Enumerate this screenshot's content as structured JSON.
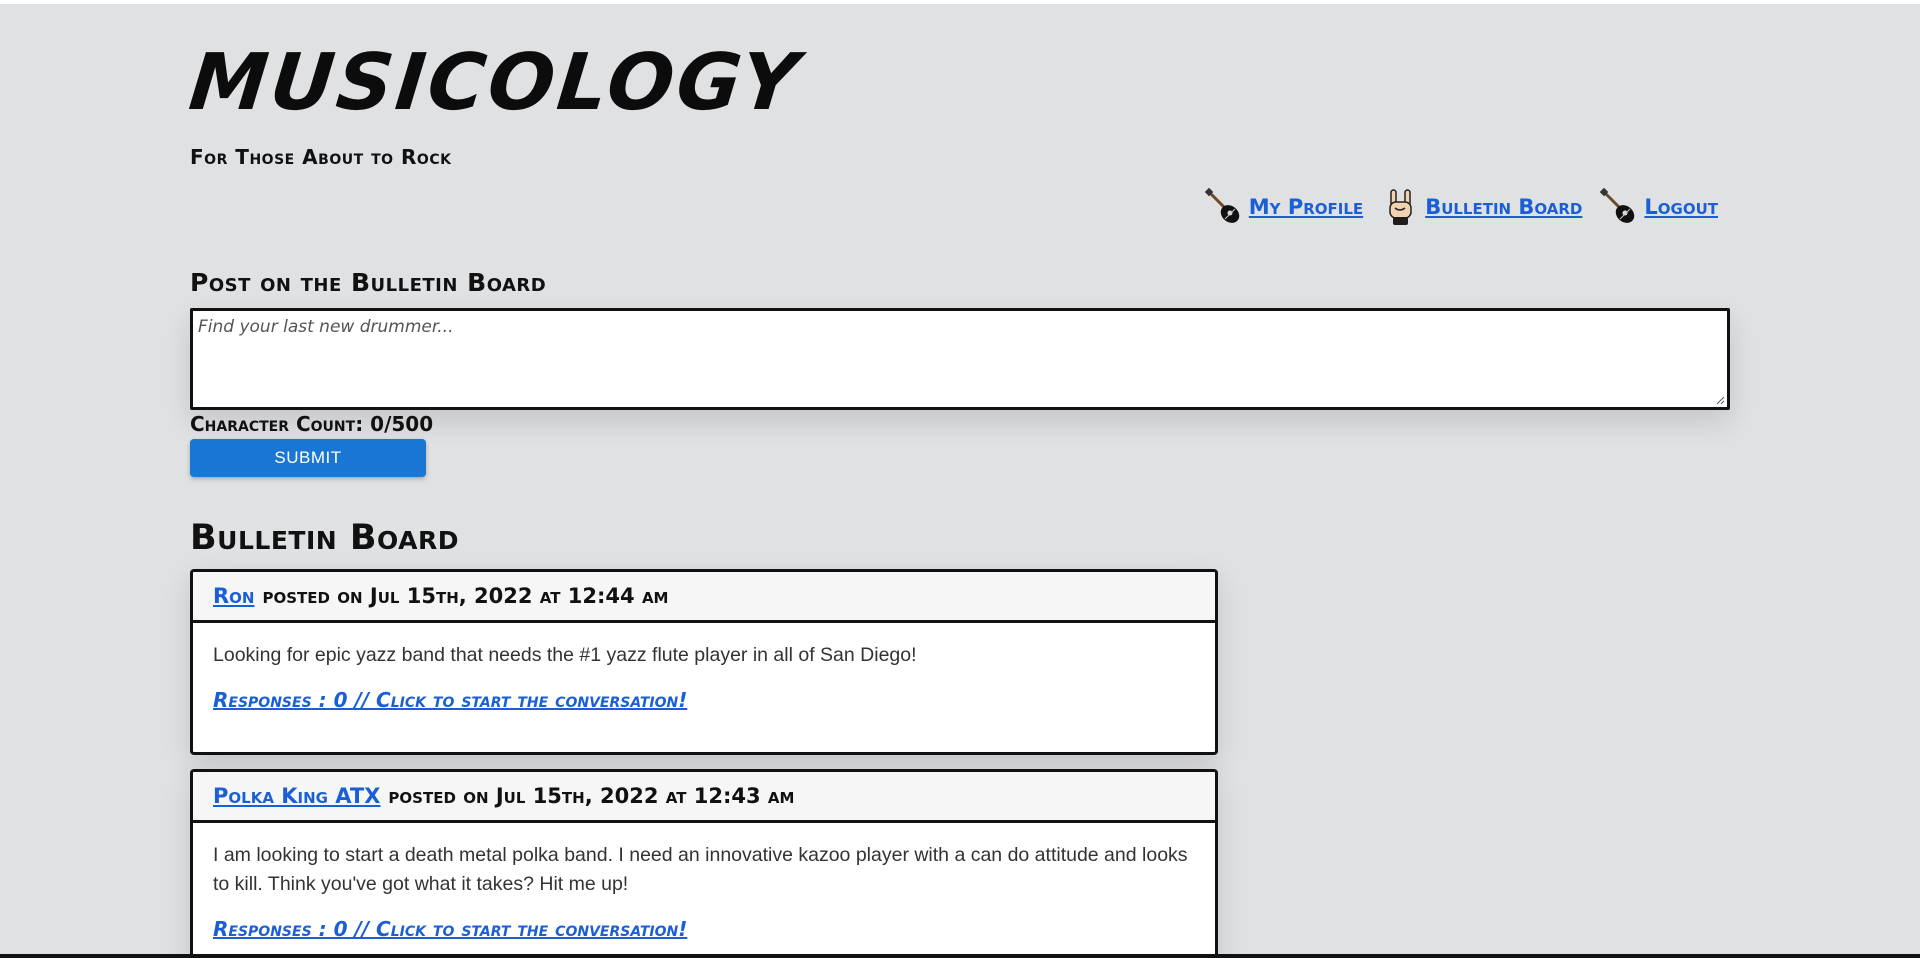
{
  "site": {
    "title": "Musicology",
    "tagline": "For Those About to Rock"
  },
  "nav": {
    "items": [
      {
        "label": "My Profile",
        "icon": "guitar-icon"
      },
      {
        "label": "Bulletin Board",
        "icon": "rock-hand-icon"
      },
      {
        "label": "Logout",
        "icon": "guitar-icon"
      }
    ]
  },
  "post_form": {
    "heading": "Post on the Bulletin Board",
    "placeholder": "Find your last new drummer...",
    "value": "",
    "char_count": "Character Count: 0/500",
    "submit_label": "SUBMIT"
  },
  "board": {
    "heading": "Bulletin Board",
    "posts": [
      {
        "author": "Ron",
        "meta": "posted on Jul 15th, 2022 at 12:44 am",
        "message": "Looking for epic yazz band that needs the #1 yazz flute player in all of San Diego!",
        "responses": "Responses : 0 // Click to start the conversation!"
      },
      {
        "author": "Polka King ATX",
        "meta": "posted on Jul 15th, 2022 at 12:43 am",
        "message": "I am looking to start a death metal polka band. I need an innovative kazoo player with a can do attitude and looks to kill. Think you've got what it takes? Hit me up!",
        "responses": "Responses : 0 // Click to start the conversation!"
      }
    ]
  },
  "colors": {
    "background": "#e0e1e3",
    "link": "#1a5fd6",
    "button": "#1976d2"
  }
}
